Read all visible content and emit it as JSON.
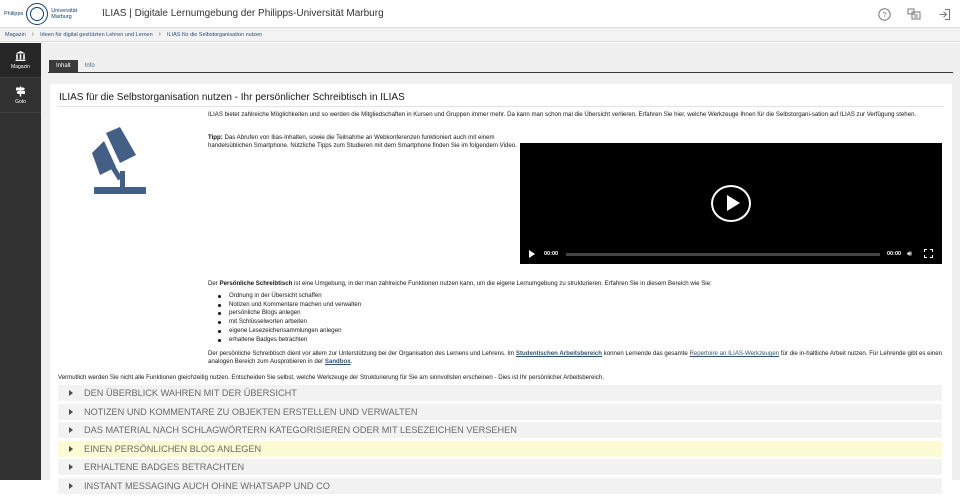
{
  "header": {
    "logo_lines": [
      "Philipps",
      "Universität",
      "Marburg"
    ],
    "title": "ILIAS | Digitale Lernumgebung der Philipps-Universität Marburg",
    "icons": [
      "help-icon",
      "notifications-icon",
      "logout-icon"
    ]
  },
  "breadcrumbs": [
    "Magazin",
    "Ideen für digital gestützten Lehren und Lernen",
    "ILIAS für die Selbstorganisation nutzen"
  ],
  "sidebar": {
    "items": [
      {
        "label": "Magazin",
        "icon": "library-icon"
      },
      {
        "label": "Goto",
        "icon": "signpost-icon"
      }
    ]
  },
  "tabs": [
    "Inhalt",
    "Info"
  ],
  "page": {
    "title": "ILIAS für die Selbstorganisation nutzen - Ihr persönlicher Schreibtisch in ILIAS",
    "intro": "ILIAS bietet zahlreiche Möglichkeiten und so werden die Mitgliedschaften in Kursen und Gruppen immer mehr. Da kann man schon mal die Übersicht verlieren. Erfahren Sie hier, welche Werkzeuge Ihnen für die Selbstorgani-sation auf ILIAS zur Verfügung stehen.",
    "tip_label": "Tipp:",
    "tip_text": " Das Abrufen von Ilias-Inhalten, sowie die Teilnahme an Webkonferenzen funktioniert auch mit einem handelsüblichen Smartphone. Nützliche Tipps zum Studieren mit dem Smartphone finden Sie im folgendem Video.",
    "video": {
      "time_current": "00:00",
      "time_total": "00:00",
      "progress": 0
    },
    "desk_pre": "Der ",
    "desk_bold": "Persönliche Schreibtisch",
    "desk_post": " ist eine Umgebung, in der man zahlreiche Funktionen nutzen kann, um die eigene Lernumgebung zu strukturieren. Erfahren Sie in diesem Bereich wie Sie:",
    "bullets": [
      "Ordnung in der Übersicht schaffen",
      "Notizen und Kommentare machen und verwalten",
      "persönliche Blogs anlegen",
      "mit Schlüsselworten arbeiten",
      "eigene Lesezeichensammlungen anlegen",
      "erhaltene Badges betrachten"
    ],
    "support_1": "Der persönliche Schreibtisch dient vor allem zur Unterstützung bei der Organisation des Lernens und Lehrens. Im ",
    "support_link1": "Studentischen Arbeitsbereich",
    "support_2": " konnen Lernende das gesamte ",
    "support_link2": "Repertoire an ILIAS-Werkzeugen",
    "support_3": " für die in-haltliche Arbeit nutzen. Für Lehrende gibt es einen analogen Bereich zum Ausprobieren in der ",
    "support_link3": "Sandbox",
    "support_4": ".",
    "closing": "Vermutlich werden Sie nicht alle Funktionen gleichzeitig nutzen. Entscheiden Sie selbst, welche Werkzeuge der Strukturierung für Sie am sinnvollsten erscheinen - Dies ist Ihr persönlicher Arbeitsbereich."
  },
  "accordion": [
    {
      "label": "DEN ÜBERBLICK WAHREN MIT DER ÜBERSICHT",
      "highlighted": false
    },
    {
      "label": "NOTIZEN UND KOMMENTARE ZU OBJEKTEN ERSTELLEN UND VERWALTEN",
      "highlighted": false
    },
    {
      "label": "DAS MATERIAL NACH SCHLAGWÖRTERN KATEGORISIEREN ODER MIT LESEZEICHEN VERSEHEN",
      "highlighted": false
    },
    {
      "label": "EINEN PERSÖNLICHEN BLOG ANLEGEN",
      "highlighted": true
    },
    {
      "label": "ERHALTENE BADGES BETRACHTEN",
      "highlighted": false
    },
    {
      "label": "INSTANT MESSAGING AUCH OHNE WHATSAPP UND CO",
      "highlighted": false
    }
  ],
  "colors": {
    "accent": "#375172",
    "lamp": "#435f86",
    "sidebar": "#313131",
    "highlight": "#fdfbd3"
  }
}
